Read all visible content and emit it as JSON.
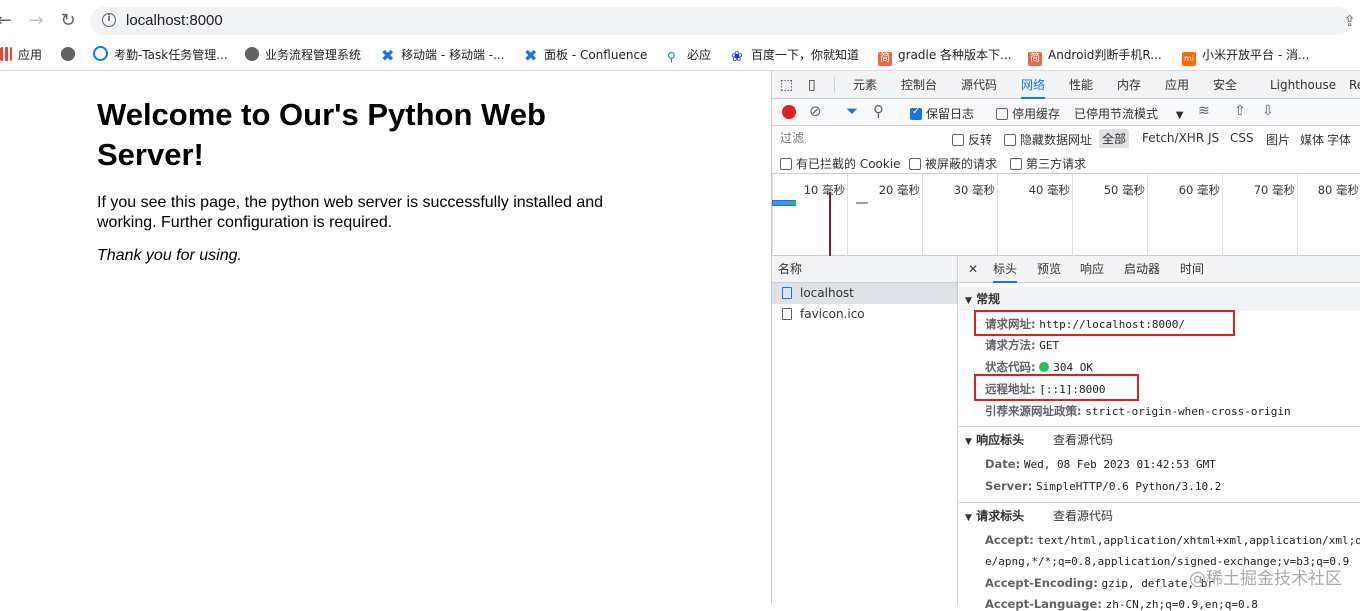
{
  "browser": {
    "url": "localhost:8000",
    "bookmarks": [
      {
        "label": "应用",
        "icon": "apps-grid-icon"
      },
      {
        "label": "",
        "icon": "globe-icon"
      },
      {
        "label": "考勤-Task任务管理...",
        "icon": "task-icon"
      },
      {
        "label": "业务流程管理系统",
        "icon": "globe-icon"
      },
      {
        "label": "移动端 - 移动端 -...",
        "icon": "confluence-icon"
      },
      {
        "label": "面板 - Confluence",
        "icon": "confluence-icon"
      },
      {
        "label": "必应",
        "icon": "search-icon"
      },
      {
        "label": "百度一下，你就知道",
        "icon": "baidu-icon"
      },
      {
        "label": "gradle 各种版本下...",
        "icon": "jianshu-icon"
      },
      {
        "label": "Android判断手机R...",
        "icon": "jianshu-icon"
      },
      {
        "label": "小米开放平台 - 消...",
        "icon": "mi-icon"
      }
    ]
  },
  "page": {
    "heading": "Welcome to Our's Python Web Server!",
    "body": "If you see this page, the python web server is successfully installed and working. Further configuration is required.",
    "thanks": "Thank you for using."
  },
  "devtools": {
    "tabs": [
      "元素",
      "控制台",
      "源代码",
      "网络",
      "性能",
      "内存",
      "应用",
      "安全",
      "Lighthouse",
      "Re"
    ],
    "active_tab": "网络",
    "toolbar": {
      "preserve_log": "保留日志",
      "disable_cache": "停用缓存",
      "throttling": "已停用节流模式"
    },
    "filter": {
      "placeholder": "过滤",
      "invert": "反转",
      "hide_data_urls": "隐藏数据网址",
      "types": [
        "全部",
        "Fetch/XHR",
        "JS",
        "CSS",
        "图片",
        "媒体",
        "字体"
      ],
      "blocked_cookies": "有已拦截的 Cookie",
      "blocked_requests": "被屏蔽的请求",
      "third_party": "第三方请求"
    },
    "timeline_ticks": [
      "10 毫秒",
      "20 毫秒",
      "30 毫秒",
      "40 毫秒",
      "50 毫秒",
      "60 毫秒",
      "70 毫秒",
      "80 毫秒"
    ],
    "name_header": "名称",
    "requests": [
      "localhost",
      "favicon.ico"
    ],
    "detail_tabs": [
      "标头",
      "预览",
      "响应",
      "启动器",
      "时间"
    ],
    "general": {
      "title": "常规",
      "request_url_k": "请求网址:",
      "request_url_v": "http://localhost:8000/",
      "method_k": "请求方法:",
      "method_v": "GET",
      "status_k": "状态代码:",
      "status_v": "304 OK",
      "remote_k": "远程地址:",
      "remote_v": "[::1]:8000",
      "referrer_k": "引荐来源网址政策:",
      "referrer_v": "strict-origin-when-cross-origin"
    },
    "response_headers": {
      "title": "响应标头",
      "view_source": "查看源代码",
      "date_k": "Date:",
      "date_v": "Wed, 08 Feb 2023 01:42:53 GMT",
      "server_k": "Server:",
      "server_v": "SimpleHTTP/0.6 Python/3.10.2"
    },
    "request_headers": {
      "title": "请求标头",
      "view_source": "查看源代码",
      "accept_k": "Accept:",
      "accept_v": "text/html,application/xhtml+xml,application/xml;q=",
      "accept_v2": "e/apng,*/*;q=0.8,application/signed-exchange;v=b3;q=0.9",
      "encoding_k": "Accept-Encoding:",
      "encoding_v": "gzip, deflate, br",
      "language_k": "Accept-Language:",
      "language_v": "zh-CN,zh;q=0.9,en;q=0.8"
    }
  },
  "watermark": "@稀土掘金技术社区"
}
